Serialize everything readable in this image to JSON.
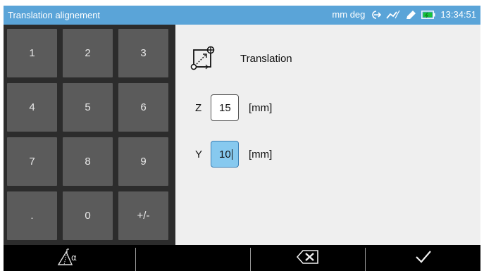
{
  "titlebar": {
    "title": "Translation alignement",
    "units": "mm deg",
    "time": "13:34:51",
    "icons": [
      "arrow-connect-icon",
      "signal-icon",
      "pen-icon",
      "battery-icon"
    ]
  },
  "keypad": {
    "keys": [
      "1",
      "2",
      "3",
      "4",
      "5",
      "6",
      "7",
      "8",
      "9",
      ".",
      "0",
      "+/-"
    ]
  },
  "panel": {
    "title": "Translation",
    "fields": [
      {
        "axis": "Z",
        "value": "15",
        "unit": "[mm]",
        "active": false
      },
      {
        "axis": "Y",
        "value": "10",
        "unit": "[mm]",
        "active": true
      }
    ]
  },
  "colors": {
    "titlebar": "#5aa4d8",
    "active_field": "#87c9ef",
    "key": "#5b5b5b",
    "panel": "#efefef"
  }
}
